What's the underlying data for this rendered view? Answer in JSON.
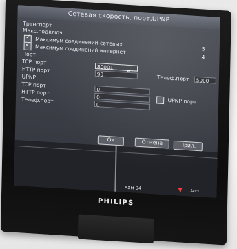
{
  "window": {
    "title": "Сетевая скорость, порт,UPNP"
  },
  "transport": {
    "heading": "Транспорт",
    "max_conn_label": "Макс.подключ.",
    "max_net_conn": {
      "label": "Максимум соединений сетевых",
      "value": "5",
      "checked": true
    },
    "max_internet_conn": {
      "label": "Максимум соединений интернет",
      "value": "4",
      "checked": true
    }
  },
  "port": {
    "heading": "Порт",
    "tcp_label": "TCP порт",
    "tcp_value": "80001",
    "http_label": "HTTP порт",
    "http_value": "90",
    "phone_label": "Телеф.порт",
    "phone_value": "5000"
  },
  "upnp": {
    "heading": "UPNP",
    "tcp_label": "TCP порт",
    "tcp_value": "0",
    "http_label": "HTTP порт",
    "http_value": "0",
    "phone_label": "Телеф.порт",
    "phone_value": "0",
    "upnp_port_label": "UPNP порт",
    "upnp_port_checked": false
  },
  "buttons": {
    "ok": "Ок",
    "cancel": "Отмена",
    "apply": "Прил."
  },
  "status": {
    "camera": "Кам 04"
  },
  "monitor": {
    "brand": "PHILIPS"
  },
  "icons": [
    "checkbox-icon",
    "mouse-cursor-icon",
    "record-icon",
    "network-icon"
  ],
  "colors": {
    "screen_bg": "#3b3e46",
    "text": "#e8e8ee",
    "record": "#ff3b3b"
  }
}
